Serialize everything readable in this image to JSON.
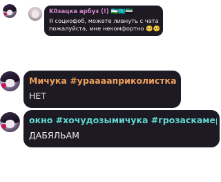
{
  "messages": [
    {
      "author": "K0зацка арбуз (!) 🇺🇿🇰🇿🇸🇾",
      "author_color": "#d98bd0",
      "text": "Я социофоб, можете ливнуть с чата пожалуйста, мне некомфортно 🥺🥺"
    },
    {
      "author": "Мичука #урааааприколистка 🦨",
      "author_color": "#f0a25a",
      "text": "НЕТ"
    },
    {
      "author": "окно #хочудозымичука #грозаскамеро...",
      "author_color": "#5fd9d2",
      "text": "ДАБЯЛЬАМ"
    }
  ]
}
